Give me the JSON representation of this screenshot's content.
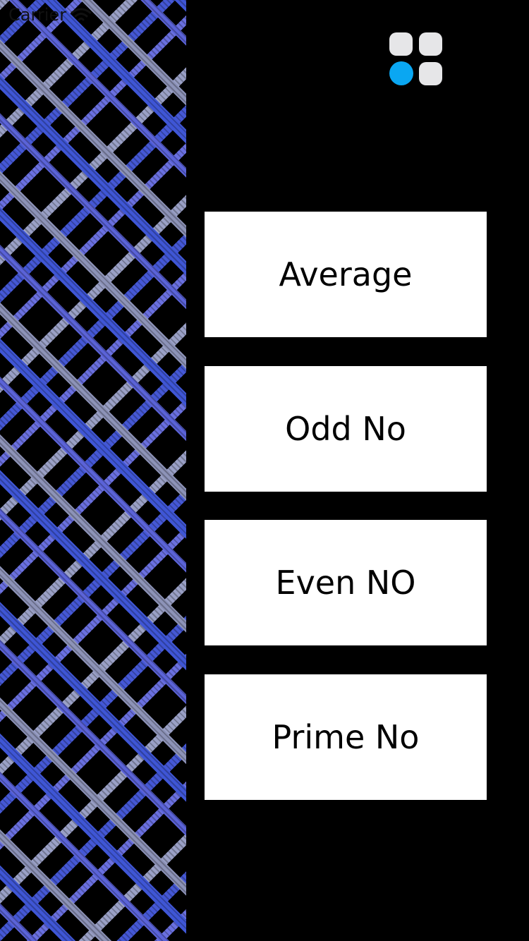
{
  "status_bar": {
    "carrier": "Carrier",
    "wifi_icon": "wifi-icon"
  },
  "menu": {
    "icon": "grid-menu-icon",
    "accent_color": "#0aa7f2",
    "tile_color": "#e6e6e8"
  },
  "buttons": [
    {
      "label": "Average"
    },
    {
      "label": "Odd No"
    },
    {
      "label": "Even NO"
    },
    {
      "label": "Prime No"
    }
  ],
  "colors": {
    "background": "#000000",
    "button_bg": "#ffffff",
    "plaid_primary": "#3f56d6",
    "plaid_secondary": "#8d93b8"
  }
}
